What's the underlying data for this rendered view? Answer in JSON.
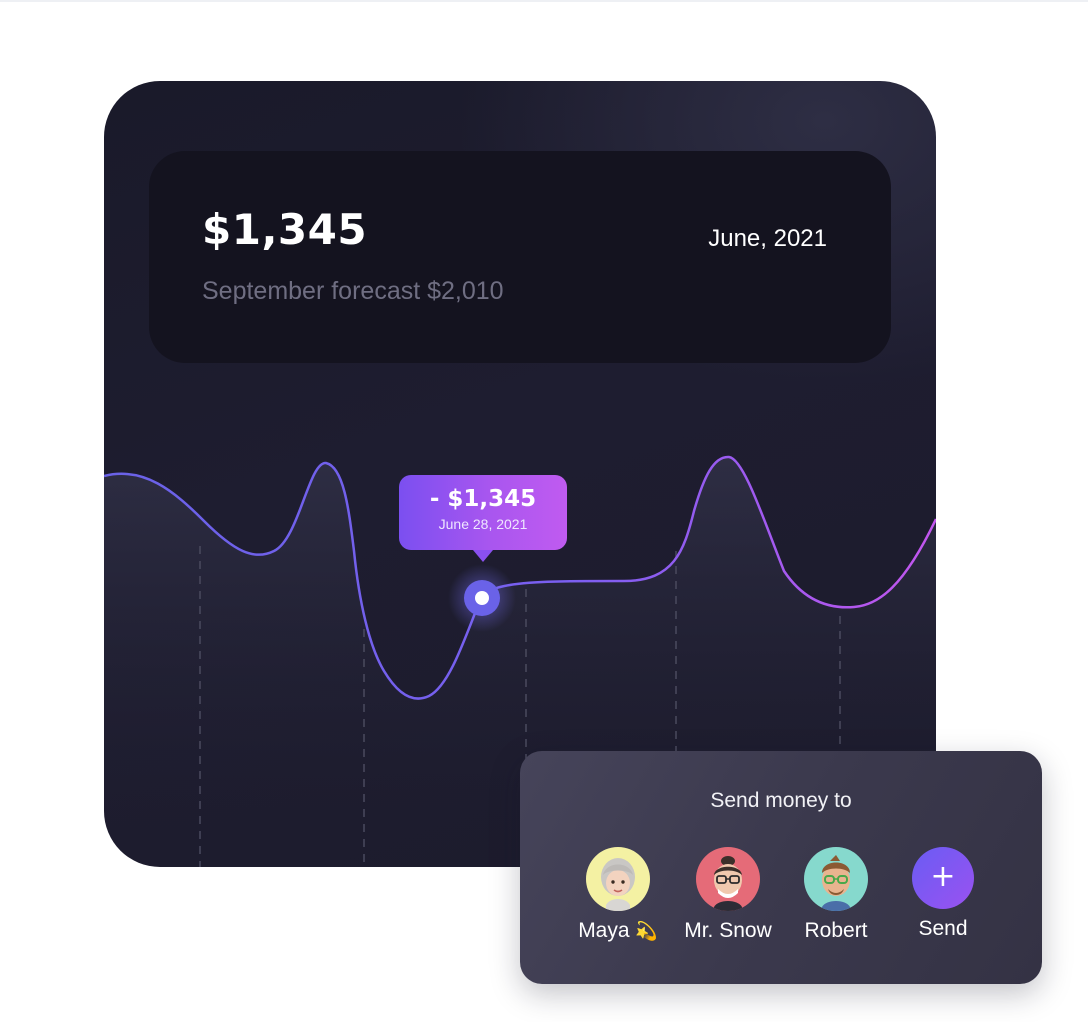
{
  "balance": {
    "amount": "$1,345",
    "forecast": "September forecast $2,010",
    "period": "June, 2021"
  },
  "tooltip": {
    "amount": "- $1,345",
    "date": "June 28, 2021"
  },
  "send_money": {
    "title": "Send money to",
    "contacts": [
      {
        "name": "Maya",
        "badge": "💫",
        "avatar_color": "#f4f1a3",
        "icon": "memoji-maya"
      },
      {
        "name": "Mr. Snow",
        "avatar_color": "#e56b78",
        "icon": "memoji-mr-snow"
      },
      {
        "name": "Robert",
        "avatar_color": "#86d9cd",
        "icon": "memoji-robert"
      }
    ],
    "send_label": "Send",
    "send_icon": "+"
  },
  "colors": {
    "card_bg": "#1c1b2c",
    "line_start": "#6a62e8",
    "line_end": "#c356ef",
    "accent": "#7b4ff0"
  }
}
